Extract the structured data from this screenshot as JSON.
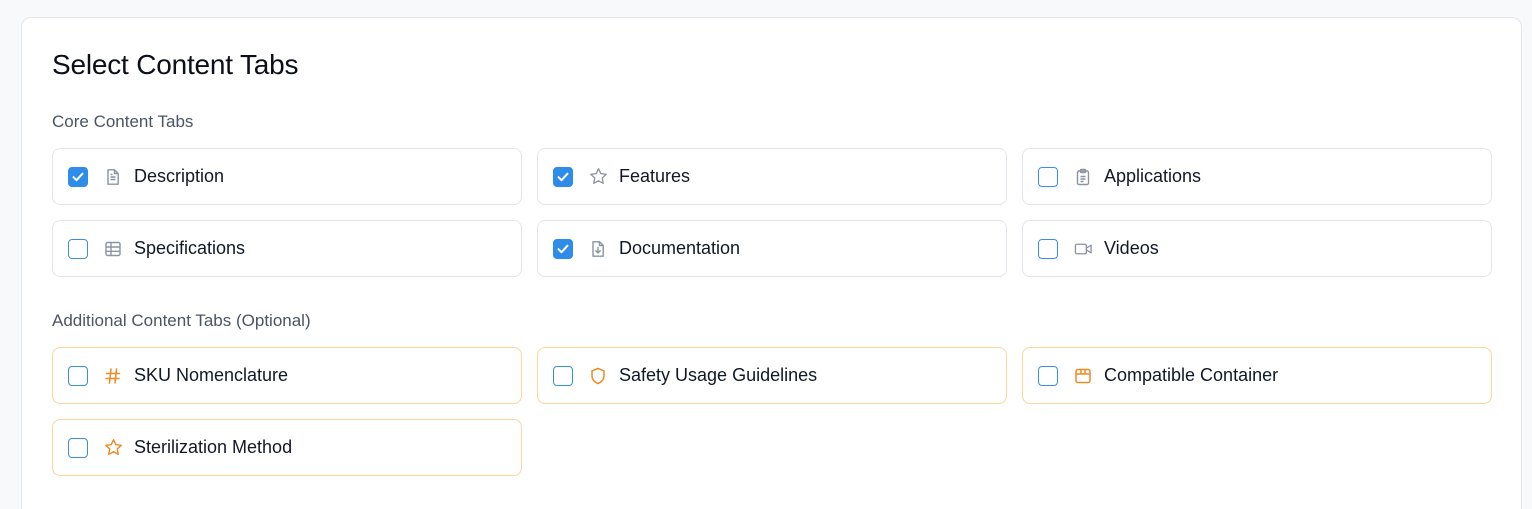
{
  "page": {
    "title": "Select Content Tabs"
  },
  "core": {
    "heading": "Core Content Tabs",
    "items": [
      {
        "label": "Description",
        "checked": true,
        "icon": "document-icon"
      },
      {
        "label": "Features",
        "checked": true,
        "icon": "star-icon"
      },
      {
        "label": "Applications",
        "checked": false,
        "icon": "clipboard-icon"
      },
      {
        "label": "Specifications",
        "checked": false,
        "icon": "table-icon"
      },
      {
        "label": "Documentation",
        "checked": true,
        "icon": "file-download-icon"
      },
      {
        "label": "Videos",
        "checked": false,
        "icon": "video-icon"
      }
    ]
  },
  "additional": {
    "heading": "Additional Content Tabs (Optional)",
    "items": [
      {
        "label": "SKU Nomenclature",
        "checked": false,
        "icon": "hash-icon"
      },
      {
        "label": "Safety Usage Guidelines",
        "checked": false,
        "icon": "shield-icon"
      },
      {
        "label": "Compatible Container",
        "checked": false,
        "icon": "package-icon"
      },
      {
        "label": "Sterilization Method",
        "checked": false,
        "icon": "star-icon"
      }
    ]
  },
  "colors": {
    "accent": "#2f8ce8",
    "core_icon": "#8a94a3",
    "additional_icon": "#f08a24",
    "additional_border": "#fbd59a"
  }
}
